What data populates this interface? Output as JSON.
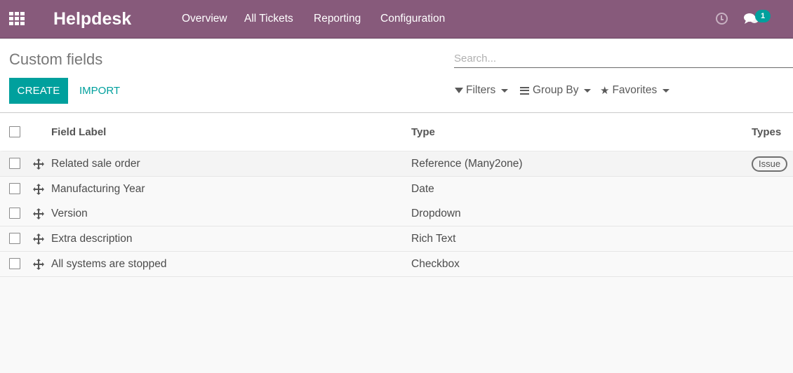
{
  "navbar": {
    "brand": "Helpdesk",
    "menu": [
      "Overview",
      "All Tickets",
      "Reporting",
      "Configuration"
    ],
    "apps_icon": "grid-icon",
    "activity_icon": "clock-icon",
    "messaging_icon": "chat-icon",
    "message_count": "1",
    "bg_color": "#875a7b"
  },
  "control_panel": {
    "title": "Custom fields",
    "create_label": "CREATE",
    "import_label": "IMPORT",
    "search_placeholder": "Search...",
    "filters_label": "Filters",
    "group_by_label": "Group By",
    "favorites_label": "Favorites",
    "accent_color": "#00a09d"
  },
  "table": {
    "columns": [
      "Field Label",
      "Type",
      "Types"
    ],
    "rows": [
      {
        "label": "Related sale order",
        "type": "Reference (Many2one)",
        "types": "Issue"
      },
      {
        "label": "Manufacturing Year",
        "type": "Date",
        "types": ""
      },
      {
        "label": "Version",
        "type": "Dropdown",
        "types": ""
      },
      {
        "label": "Extra description",
        "type": "Rich Text",
        "types": ""
      },
      {
        "label": "All systems are stopped",
        "type": "Checkbox",
        "types": ""
      }
    ]
  }
}
